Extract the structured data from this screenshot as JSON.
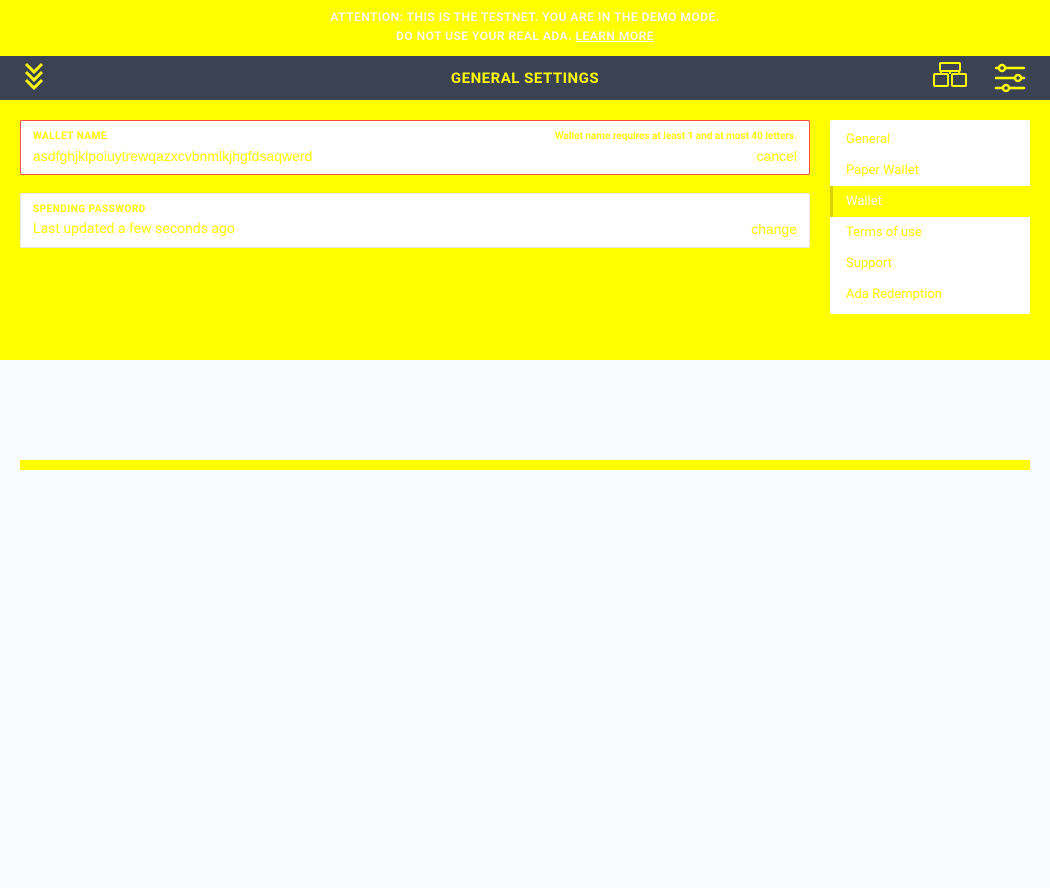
{
  "banner": {
    "line1": "ATTENTION: THIS IS THE TESTNET. YOU ARE IN THE DEMO MODE.",
    "line2_prefix": "DO NOT USE YOUR REAL ADA. ",
    "line2_link": "LEARN MORE"
  },
  "topbar": {
    "title": "GENERAL SETTINGS"
  },
  "fields": {
    "wallet_name": {
      "label": "WALLET NAME",
      "hint": "Wallet name requires at least 1 and at most 40 letters.",
      "value": "asdfghjklpoiuytrewqazxcvbnmlkjhgfdsaqwerd",
      "action": "cancel"
    },
    "spending_password": {
      "label": "SPENDING PASSWORD",
      "value": "Last updated a few seconds ago",
      "action": "change"
    }
  },
  "nav": {
    "items": [
      {
        "label": "General",
        "active": false
      },
      {
        "label": "Paper Wallet",
        "active": false
      },
      {
        "label": "Wallet",
        "active": true
      },
      {
        "label": "Terms of use",
        "active": false
      },
      {
        "label": "Support",
        "active": false
      },
      {
        "label": "Ada Redemption",
        "active": false
      }
    ]
  },
  "icons": {
    "back": "back-arrow-icon",
    "wallets": "wallets-icon",
    "settings_sliders": "settings-sliders-icon"
  },
  "colors": {
    "accent": "#ffff00",
    "error_border": "#ff4d4d",
    "topbar_bg": "#3b4252"
  }
}
